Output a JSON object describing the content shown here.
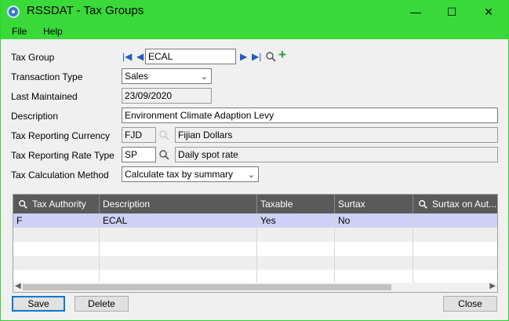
{
  "window": {
    "title": "RSSDAT - Tax Groups",
    "minimize_glyph": "—",
    "maximize_glyph": "☐",
    "close_glyph": "✕"
  },
  "menu": [
    "File",
    "Help"
  ],
  "form": {
    "tax_group": {
      "label": "Tax Group",
      "value": "ECAL"
    },
    "transaction_type": {
      "label": "Transaction Type",
      "value": "Sales"
    },
    "last_maintained": {
      "label": "Last Maintained",
      "value": "23/09/2020"
    },
    "description": {
      "label": "Description",
      "value": "Environment Climate Adaption Levy"
    },
    "reporting_currency": {
      "label": "Tax Reporting Currency",
      "code": "FJD",
      "name": "Fijian Dollars"
    },
    "reporting_rate_type": {
      "label": "Tax Reporting Rate Type",
      "code": "SP",
      "name": "Daily spot rate"
    },
    "calculation_method": {
      "label": "Tax Calculation Method",
      "value": "Calculate tax by summary"
    }
  },
  "nav_icons": {
    "first": "|◀",
    "prev": "◀",
    "next": "▶",
    "last": "▶|",
    "add": "+"
  },
  "grid": {
    "columns": [
      "Tax Authority",
      "Description",
      "Taxable",
      "Surtax",
      "Surtax on Aut..."
    ],
    "rows": [
      {
        "authority": "F",
        "description": "ECAL",
        "taxable": "Yes",
        "surtax": "No",
        "surtax_on": ""
      }
    ]
  },
  "buttons": {
    "save": "Save",
    "delete": "Delete",
    "close": "Close"
  },
  "colors": {
    "titlebar": "#39d939",
    "grid_header": "#5a5a5a",
    "selected_row": "#cfd0f5",
    "nav_blue": "#1f5fbf",
    "add_green": "#2a9d2a"
  }
}
